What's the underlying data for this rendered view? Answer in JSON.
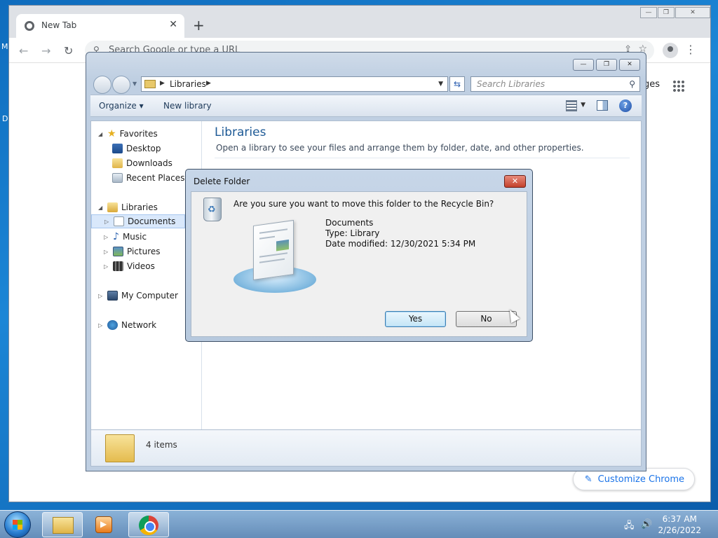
{
  "desktop": {
    "letters": [
      "M",
      "D"
    ]
  },
  "chrome": {
    "tab_title": "New Tab",
    "tab_close": "✕",
    "new_tab": "+",
    "window_buttons": [
      "—",
      "❐",
      "✕"
    ],
    "nav": {
      "back": "←",
      "forward": "→",
      "reload": "↻"
    },
    "omnibox_placeholder": "Search Google or type a URL",
    "menu": "⋮",
    "images_link": "ges",
    "customize_label": "Customize Chrome"
  },
  "explorer": {
    "window_buttons": [
      "—",
      "❐",
      "✕"
    ],
    "address": {
      "location": "Libraries"
    },
    "search_placeholder": "Search Libraries",
    "commands": {
      "organize": "Organize ▾",
      "new_library": "New library"
    },
    "help": "?",
    "nav": {
      "favorites": {
        "label": "Favorites",
        "items": [
          "Desktop",
          "Downloads",
          "Recent Places"
        ]
      },
      "libraries": {
        "label": "Libraries",
        "items": [
          "Documents",
          "Music",
          "Pictures",
          "Videos"
        ]
      },
      "computer": "My Computer",
      "network": "Network"
    },
    "content": {
      "title": "Libraries",
      "description": "Open a library to see your files and arrange them by folder, date, and other properties."
    },
    "details": {
      "count": "4 items"
    }
  },
  "dialog": {
    "title": "Delete Folder",
    "close": "✕",
    "question": "Are you sure you want to move this folder to the Recycle Bin?",
    "item": {
      "name": "Documents",
      "type": "Type: Library",
      "modified": "Date modified: 12/30/2021 5:34 PM"
    },
    "yes_label": "Yes",
    "no_label": "No"
  },
  "taskbar": {
    "time": "6:37 AM",
    "date": "2/26/2022",
    "tray": {
      "network": "🖧",
      "volume": "🔊"
    }
  }
}
